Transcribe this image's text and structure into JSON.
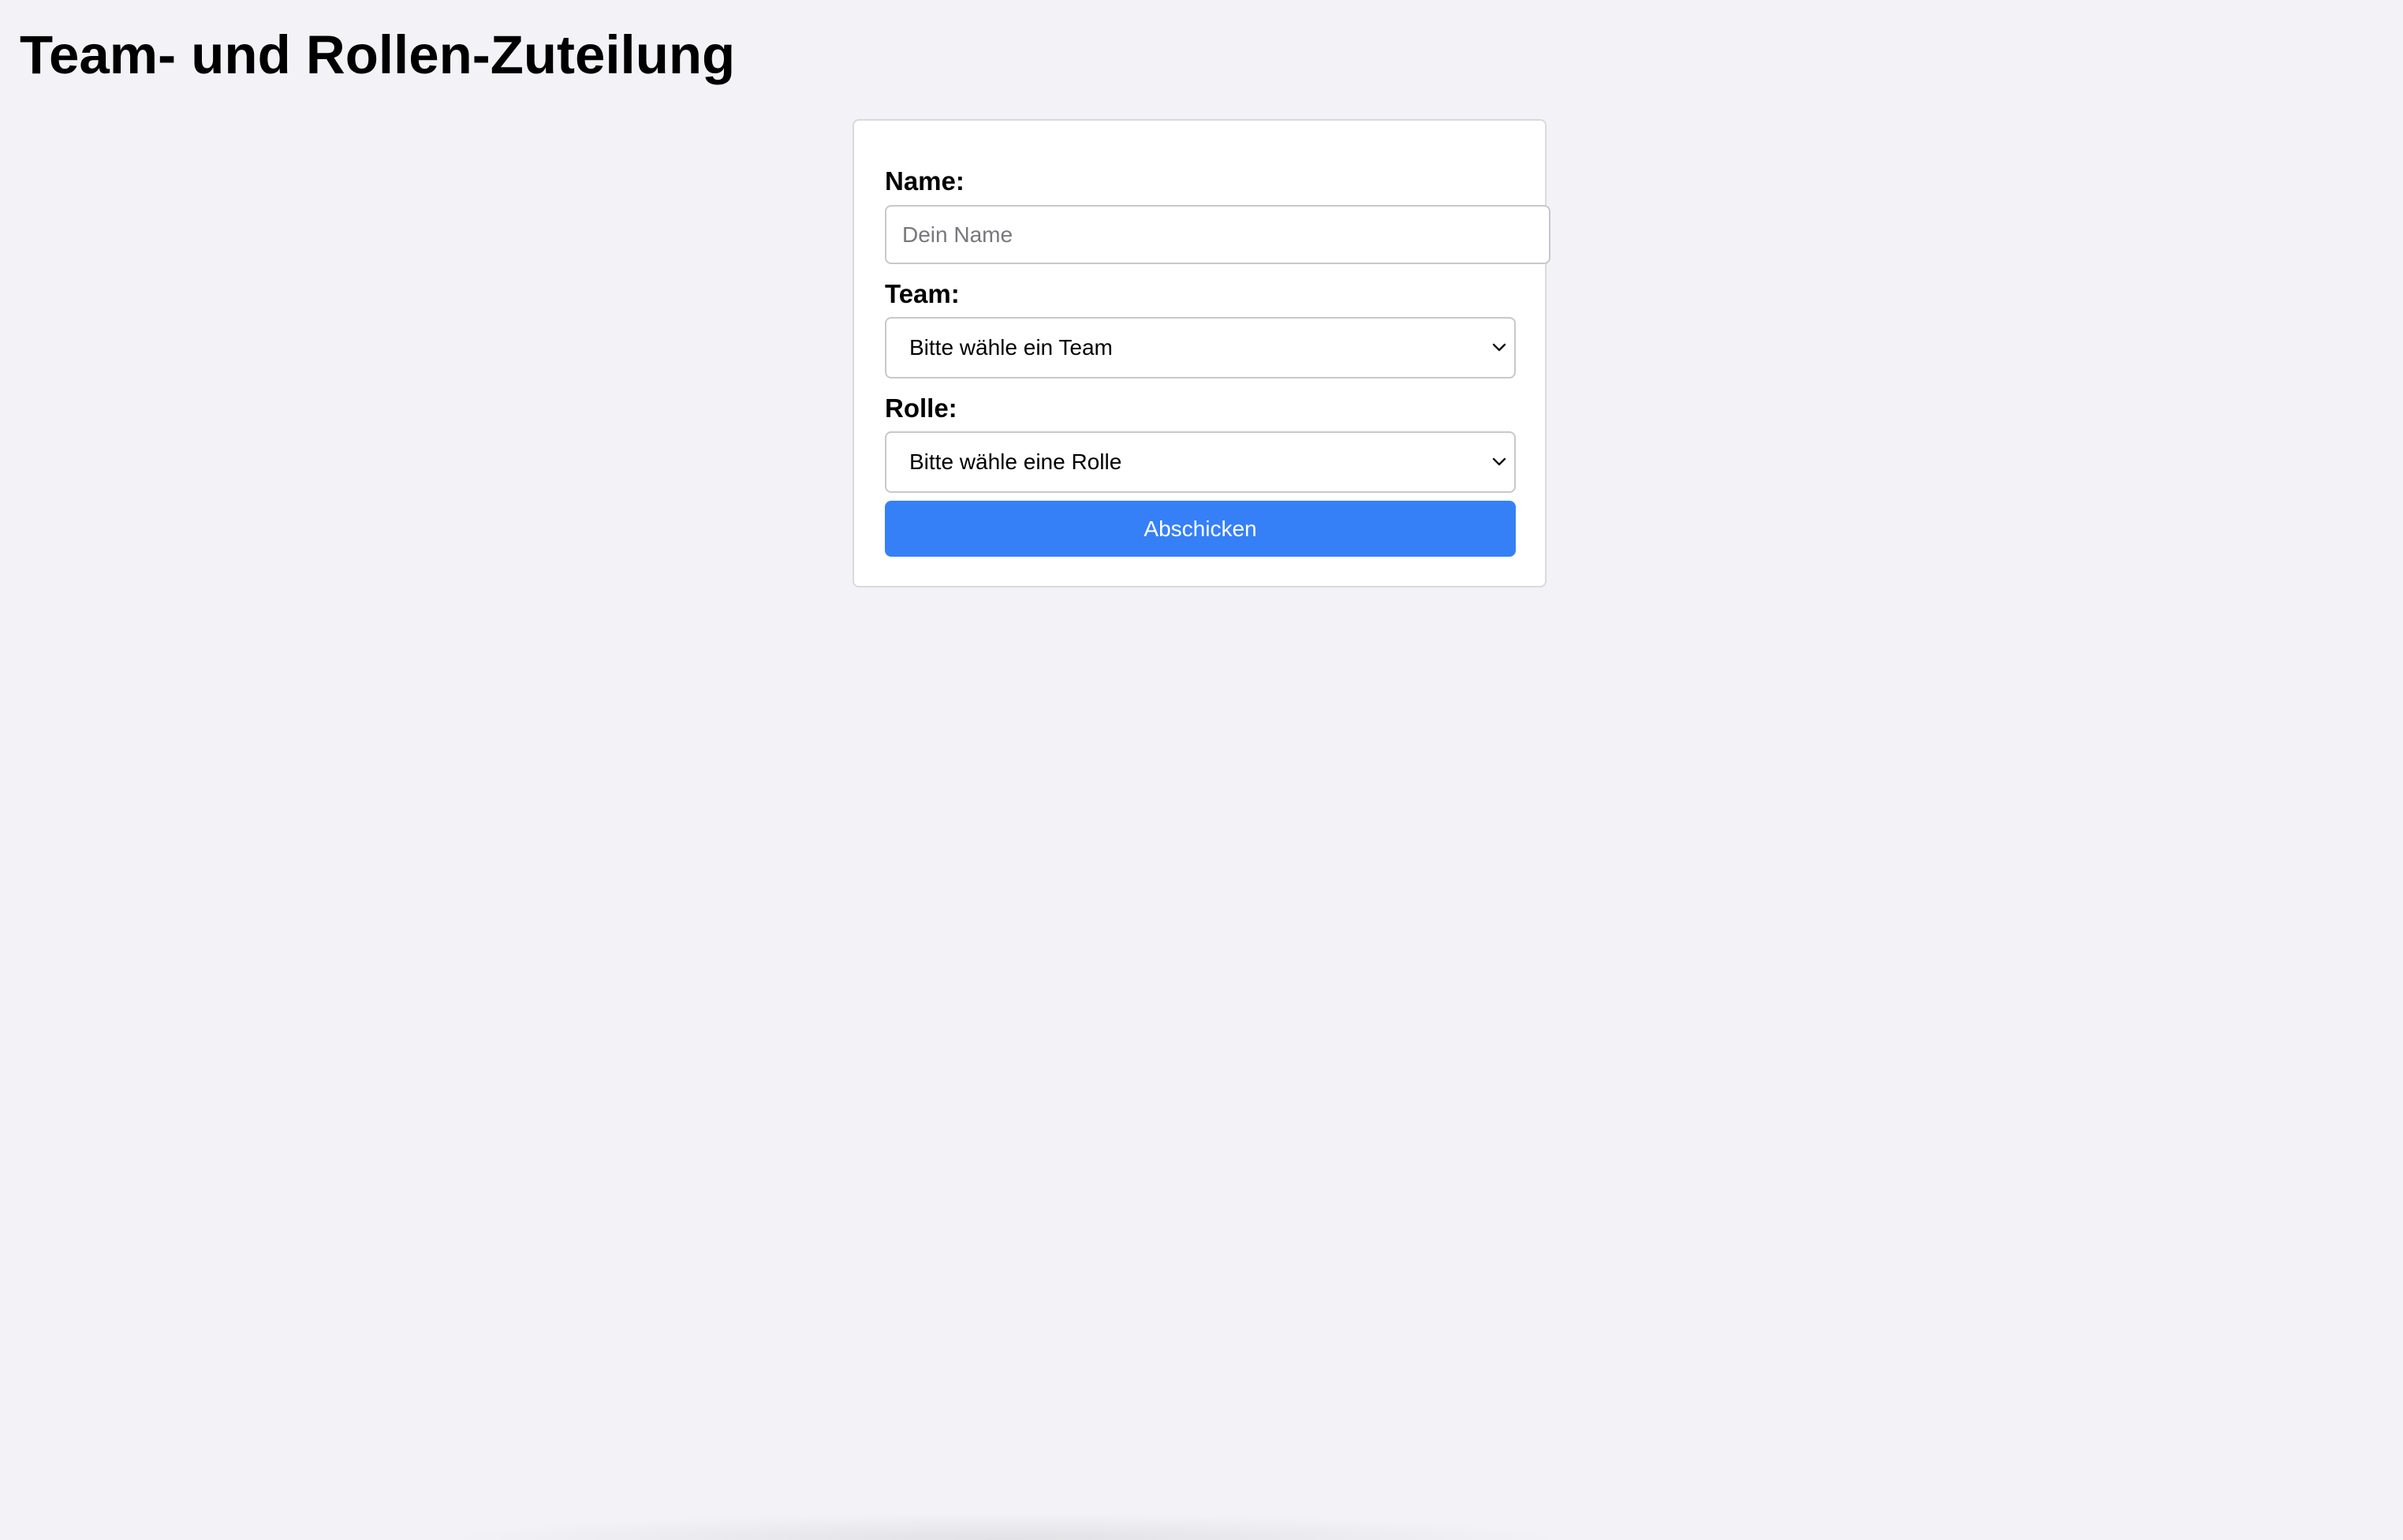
{
  "page": {
    "title": "Team- und Rollen-Zuteilung"
  },
  "form": {
    "name": {
      "label": "Name:",
      "value": "",
      "placeholder": "Dein Name"
    },
    "team": {
      "label": "Team:",
      "selected": "Bitte wähle ein Team",
      "icon": "chevron-down-icon"
    },
    "role": {
      "label": "Rolle:",
      "selected": "Bitte wähle eine Rolle",
      "icon": "chevron-down-icon"
    },
    "submit_label": "Abschicken"
  },
  "colors": {
    "background": "#f3f3f7",
    "card": "#ffffff",
    "accent": "#3580f6",
    "button_text": "#ffffff"
  }
}
